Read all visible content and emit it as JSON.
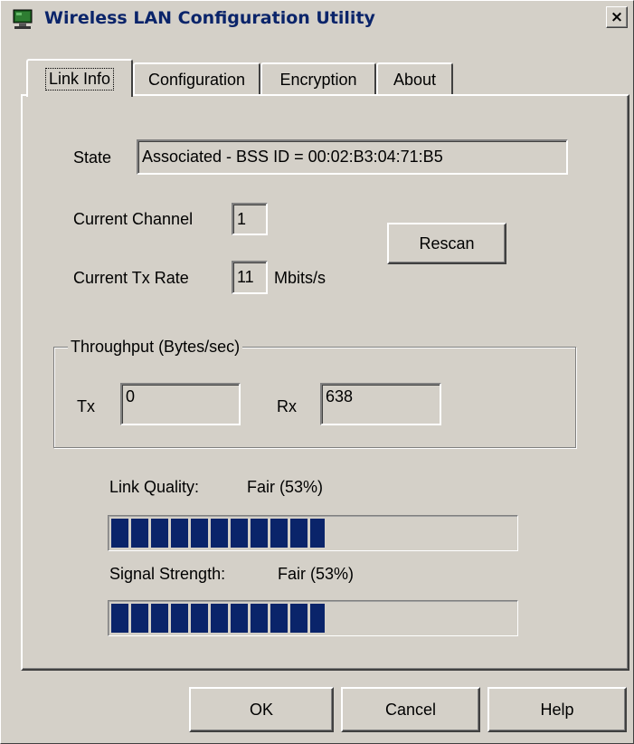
{
  "window": {
    "title": "Wireless LAN Configuration Utility",
    "close_label": "×"
  },
  "tabs": [
    {
      "label": "Link Info",
      "active": true
    },
    {
      "label": "Configuration",
      "active": false
    },
    {
      "label": "Encryption",
      "active": false
    },
    {
      "label": "About",
      "active": false
    }
  ],
  "link_info": {
    "state_label": "State",
    "state_value": "Associated - BSS ID = 00:02:B3:04:71:B5",
    "channel_label": "Current Channel",
    "channel_value": "1",
    "tx_rate_label": "Current Tx Rate",
    "tx_rate_value": "11",
    "tx_rate_unit": "Mbits/s",
    "rescan_label": "Rescan"
  },
  "throughput": {
    "title": "Throughput (Bytes/sec)",
    "tx_label": "Tx",
    "tx_value": "0",
    "rx_label": "Rx",
    "rx_value": "638"
  },
  "link_quality": {
    "label": "Link Quality:",
    "value_text": "Fair (53%)",
    "percent": 53
  },
  "signal_strength": {
    "label": "Signal Strength:",
    "value_text": "Fair (53%)",
    "percent": 53
  },
  "buttons": {
    "ok": "OK",
    "cancel": "Cancel",
    "help": "Help"
  },
  "colors": {
    "progress_block": "#0a246a",
    "title_text": "#0a246a",
    "face": "#d4d0c8"
  }
}
